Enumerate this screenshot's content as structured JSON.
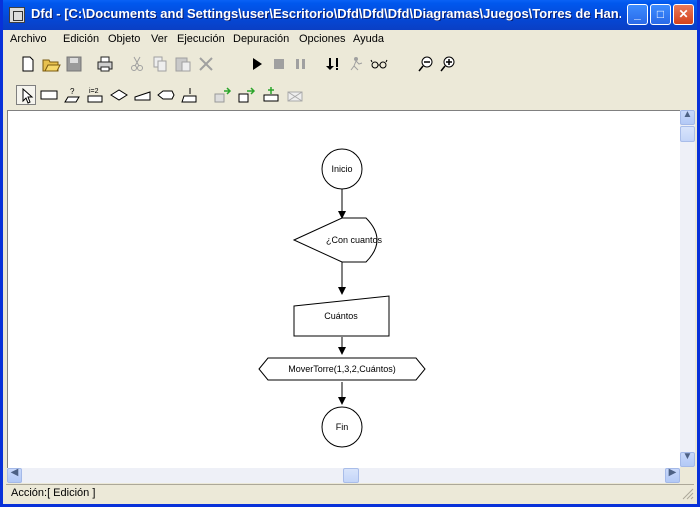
{
  "window": {
    "title": "Dfd - [C:\\Documents and Settings\\user\\Escritorio\\Dfd\\Dfd\\Dfd\\Diagramas\\Juegos\\Torres de Han...",
    "controls": {
      "minimize": "_",
      "maximize": "□",
      "close": "✕"
    }
  },
  "menu": [
    "Archivo",
    "Edición",
    "Objeto",
    "Ver",
    "Ejecución",
    "Depuración",
    "Opciones",
    "Ayuda"
  ],
  "toolbar_main": [
    "new-icon",
    "open-icon",
    "save-icon",
    "print-icon",
    "cut-icon",
    "copy-icon",
    "paste-icon",
    "delete-icon",
    "run-icon",
    "stop-icon",
    "pause-icon",
    "step-icon",
    "trace-icon",
    "watch-icon",
    "zoom-out-icon",
    "zoom-in-icon"
  ],
  "toolbar_objects": [
    "pointer-icon",
    "cycle-icon",
    "read-icon",
    "for-icon",
    "decision-icon",
    "write-icon",
    "output-icon",
    "assign-icon",
    "subprogram-prev-icon",
    "subprogram-next-icon",
    "subprogram-new-icon",
    "subprogram-delete-icon"
  ],
  "diagram": {
    "start": "Inicio",
    "read": "¿Con cuantos",
    "input": "Cuántos",
    "call": "MoverTorre(1,3,2,Cuántos)",
    "end": "Fin"
  },
  "status": {
    "text": "Acción:[ Edición ]"
  },
  "colors": {
    "titlebar": "#0548d6",
    "face": "#ece9d8",
    "canvas": "#ffffff",
    "close": "#d5421b"
  }
}
